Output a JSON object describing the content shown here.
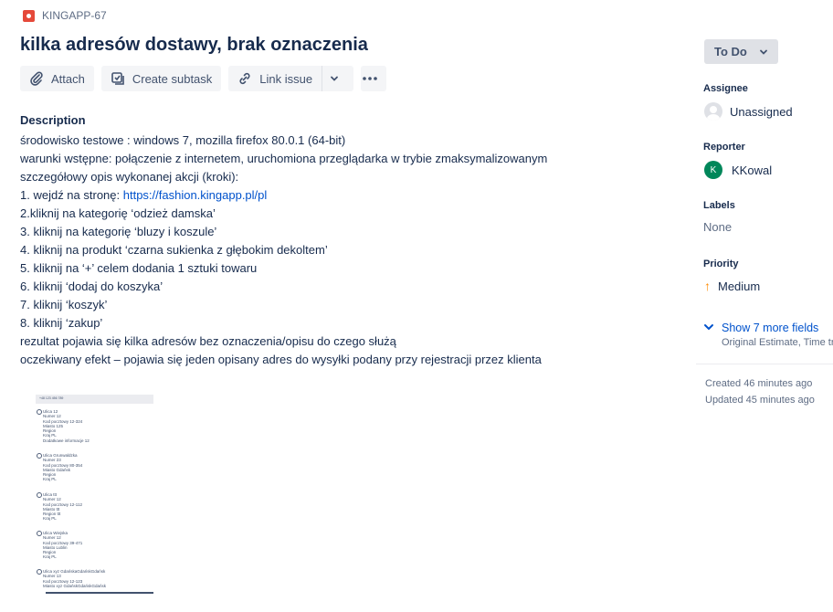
{
  "issue": {
    "key": "KINGAPP-67",
    "summary": "kilka adresów dostawy, brak oznaczenia"
  },
  "toolbar": {
    "attach_label": "Attach",
    "subtask_label": "Create subtask",
    "link_label": "Link issue"
  },
  "description": {
    "title": "Description",
    "line1": "środowisko testowe : windows 7, mozilla firefox 80.0.1 (64-bit)",
    "line2": "warunki wstępne: połączenie z internetem, uruchomiona przeglądarka w trybie zmaksymalizowanym",
    "line3": "szczegółowy opis wykonanej akcji (kroki):",
    "step1_prefix": "1. wejdź na stronę: ",
    "step1_link": "https://fashion.kingapp.pl/pl",
    "step2": "2.kliknij na kategorię ‘odzież damska’",
    "step3": "3. kliknij na kategorię ‘bluzy i koszule’",
    "step4": "4. kliknij na produkt ‘czarna sukienka z głębokim dekoltem’",
    "step5": "5. kliknij na ‘+’ celem dodania 1 sztuki towaru",
    "step6": "6. kliknij ‘dodaj do koszyka’",
    "step7": "7. kliknij ‘koszyk’",
    "step8": "8. kliknij ‘zakup’",
    "result": "rezultat pojawia się kilka adresów bez oznaczenia/opisu do czego służą",
    "expected": "oczekiwany efekt – pojawia się jeden opisany adres do wysyłki podany przy rejestracji przez klienta"
  },
  "attachment": {
    "header_text": "+48 123 456 789",
    "addresses": [
      [
        "Ulica 12",
        "Numer 12",
        "Kod pocztowy 12-324",
        "Miasto 125",
        "Region",
        "Kraj PL",
        "Dodatkowe informacje 12"
      ],
      [
        "Ulica Grunwaldzka",
        "Numer 23",
        "Kod pocztowy 80-354",
        "Miasto Gdańsk",
        "Region",
        "Kraj PL"
      ],
      [
        "Ulica ttt",
        "Numer 12",
        "Kod pocztowy 12-112",
        "Miasto ttt",
        "Region ttt",
        "Kraj PL"
      ],
      [
        "Ulica Wiejska",
        "Numer 12",
        "Kod pocztowy 39-471",
        "Miasto Lublin",
        "Region",
        "Kraj PL"
      ],
      [
        "Ulica xyz GdańskaGdańskGdańsk",
        "Numer 13",
        "Kod pocztowy 12-123",
        "Miasto xyz GdańskGdańskGdańsk"
      ]
    ]
  },
  "sidebar": {
    "status": "To Do",
    "assignee_label": "Assignee",
    "assignee_value": "Unassigned",
    "reporter_label": "Reporter",
    "reporter_initial": "K",
    "reporter_value": "KKowal",
    "labels_label": "Labels",
    "labels_value": "None",
    "priority_label": "Priority",
    "priority_value": "Medium",
    "more_fields_label": "Show 7 more fields",
    "more_fields_sub": "Original Estimate, Time tr",
    "created": "Created 46 minutes ago",
    "updated": "Updated 45 minutes ago"
  },
  "colors": {
    "link": "#0052cc",
    "bug_icon": "#e5493a",
    "reporter_avatar": "#00875a",
    "priority_medium": "#ff8b00"
  }
}
